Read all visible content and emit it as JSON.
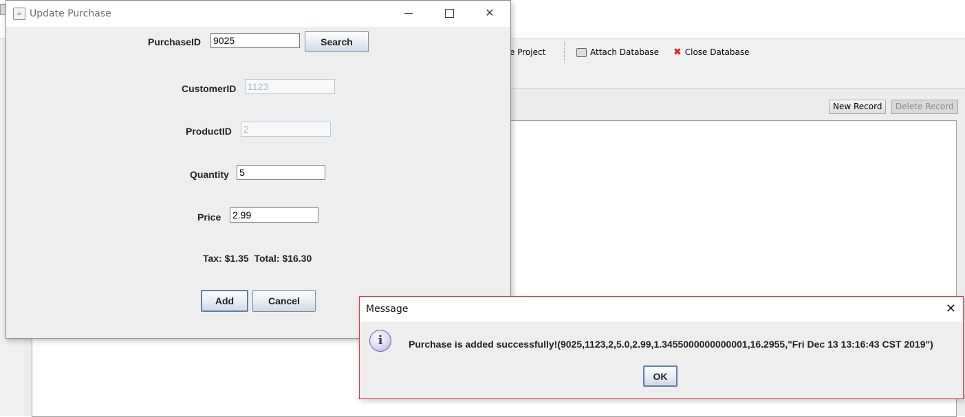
{
  "background": {
    "toolbar": {
      "partial_project_label": "e Project",
      "attach_database_label": "Attach Database",
      "close_database_label": "Close Database"
    },
    "new_record_label": "New Record",
    "delete_record_label": "Delete Record"
  },
  "update_dialog": {
    "title": "Update Purchase",
    "purchase_id_label": "PurchaseID",
    "purchase_id_value": "9025",
    "search_label": "Search",
    "customer_id_label": "CustomerID",
    "customer_id_value": "1123",
    "product_id_label": "ProductID",
    "product_id_value": "2",
    "quantity_label": "Quantity",
    "quantity_value": "5",
    "price_label": "Price",
    "price_value": "2.99",
    "summary": "Tax: $1.35  Total: $16.30",
    "add_label": "Add",
    "cancel_label": "Cancel"
  },
  "message_dialog": {
    "title": "Message",
    "text": "Purchase is added successfully!(9025,1123,2,5.0,2.99,1.3455000000000001,16.2955,\"Fri Dec 13 13:16:43 CST 2019\")",
    "ok_label": "OK"
  },
  "colors": {
    "message_border": "#d9343c",
    "close_database_icon": "#e02020",
    "button_border": "#7a8a9e"
  },
  "icons": [
    "java-cup-icon",
    "minimize-icon",
    "maximize-icon",
    "close-icon",
    "database-icon",
    "close-database-icon",
    "info-icon"
  ]
}
